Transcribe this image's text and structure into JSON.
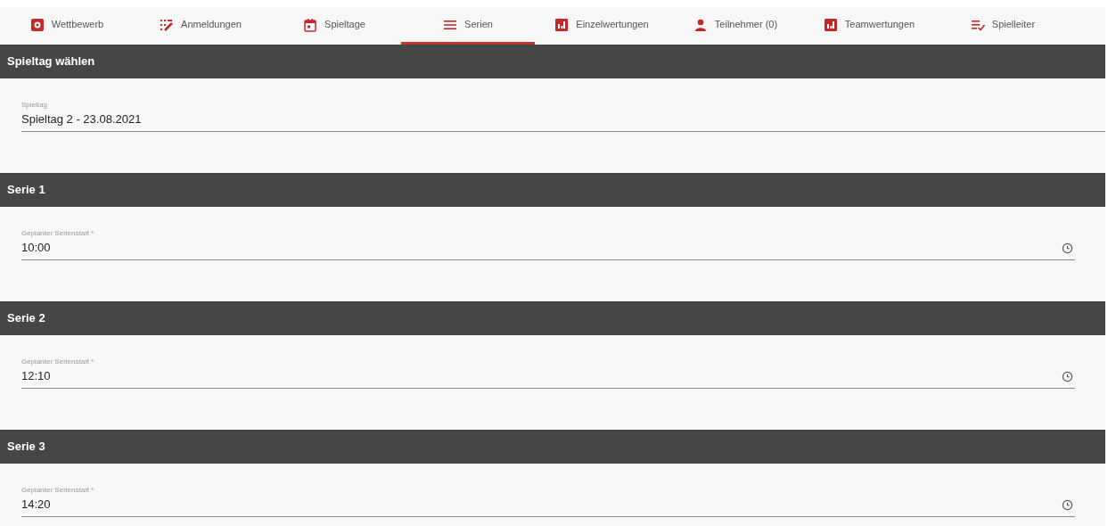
{
  "tabs": [
    {
      "label": "Wettbewerb",
      "kind": "gear",
      "selected": false
    },
    {
      "label": "Anmeldungen",
      "kind": "editlist",
      "selected": false
    },
    {
      "label": "Spieltage",
      "kind": "calendar",
      "selected": false
    },
    {
      "label": "Serien",
      "kind": "lines",
      "selected": true
    },
    {
      "label": "Einzelwertungen",
      "kind": "chart",
      "selected": false
    },
    {
      "label": "Teilnehmer (0)",
      "kind": "person",
      "selected": false
    },
    {
      "label": "Teamwertungen",
      "kind": "chart",
      "selected": false
    },
    {
      "label": "Spielleiter",
      "kind": "checklist",
      "selected": false
    }
  ],
  "sections": [
    {
      "title": "Spieltag wählen",
      "field": {
        "kind": "select",
        "label": "Spieltag",
        "value": "Spieltag 2 - 23.08.2021"
      }
    },
    {
      "title": "Serie 1",
      "field": {
        "kind": "time",
        "label": "Geplanter Serienstart *",
        "value": "10:00"
      }
    },
    {
      "title": "Serie 2",
      "field": {
        "kind": "time",
        "label": "Geplanter Serienstart *",
        "value": "12:10"
      }
    },
    {
      "title": "Serie 3",
      "field": {
        "kind": "time",
        "label": "Geplanter Serienstart *",
        "value": "14:20"
      }
    }
  ]
}
